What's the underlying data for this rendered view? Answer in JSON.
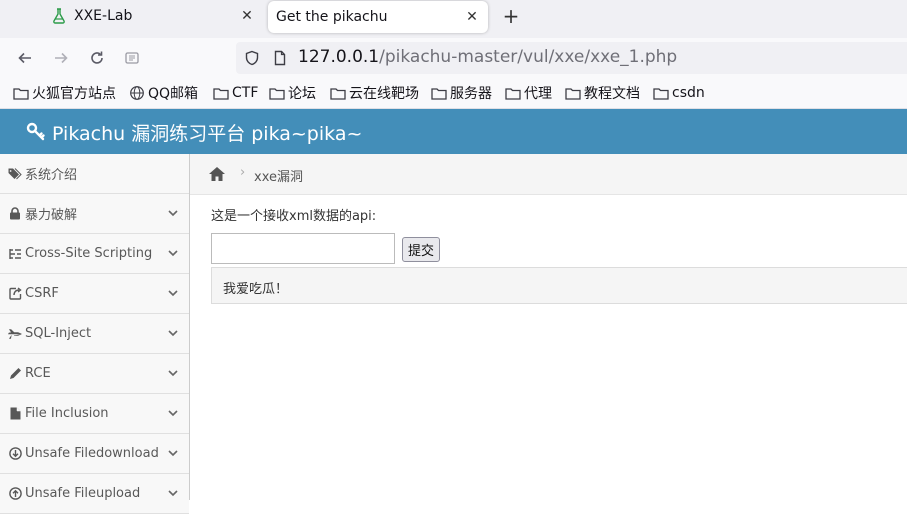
{
  "browser": {
    "tabs": [
      {
        "title": "XXE-Lab",
        "icon": "flask-icon",
        "active": false
      },
      {
        "title": "Get the pikachu",
        "icon": "",
        "active": true
      }
    ],
    "new_tab": "+",
    "url": {
      "host": "127.0.0.1",
      "path": "/pikachu-master/vul/xxe/xxe_1.php"
    },
    "bookmarks": [
      {
        "label": "火狐官方站点",
        "icon": "folder-icon"
      },
      {
        "label": "QQ邮箱",
        "icon": "globe-icon"
      },
      {
        "label": "CTF",
        "icon": "folder-icon"
      },
      {
        "label": "论坛",
        "icon": "folder-icon"
      },
      {
        "label": "云在线靶场",
        "icon": "folder-icon"
      },
      {
        "label": "服务器",
        "icon": "folder-icon"
      },
      {
        "label": "代理",
        "icon": "folder-icon"
      },
      {
        "label": "教程文档",
        "icon": "folder-icon"
      },
      {
        "label": "csdn",
        "icon": "folder-icon"
      }
    ]
  },
  "app": {
    "brand": "Pikachu 漏洞练习平台 pika~pika~",
    "accent": "#438eb9"
  },
  "sidebar": {
    "items": [
      {
        "label": "系统介绍",
        "icon": "tags-icon",
        "has_chevron": false
      },
      {
        "label": "暴力破解",
        "icon": "lock-icon",
        "has_chevron": true
      },
      {
        "label": "Cross-Site Scripting",
        "icon": "list-icon",
        "has_chevron": true
      },
      {
        "label": "CSRF",
        "icon": "share-icon",
        "has_chevron": true
      },
      {
        "label": "SQL-Inject",
        "icon": "fighter-jet-icon",
        "has_chevron": true
      },
      {
        "label": "RCE",
        "icon": "pencil-icon",
        "has_chevron": true
      },
      {
        "label": "File Inclusion",
        "icon": "file-icon",
        "has_chevron": true
      },
      {
        "label": "Unsafe Filedownload",
        "icon": "download-icon",
        "has_chevron": true
      },
      {
        "label": "Unsafe Fileupload",
        "icon": "upload-icon",
        "has_chevron": true
      }
    ]
  },
  "main": {
    "breadcrumb": {
      "home_icon": "home-icon",
      "separator": "›",
      "current": "xxe漏洞"
    },
    "api_label": "这是一个接收xml数据的api:",
    "input_value": "",
    "submit_label": "提交",
    "result_text": "我爱吃瓜！"
  }
}
